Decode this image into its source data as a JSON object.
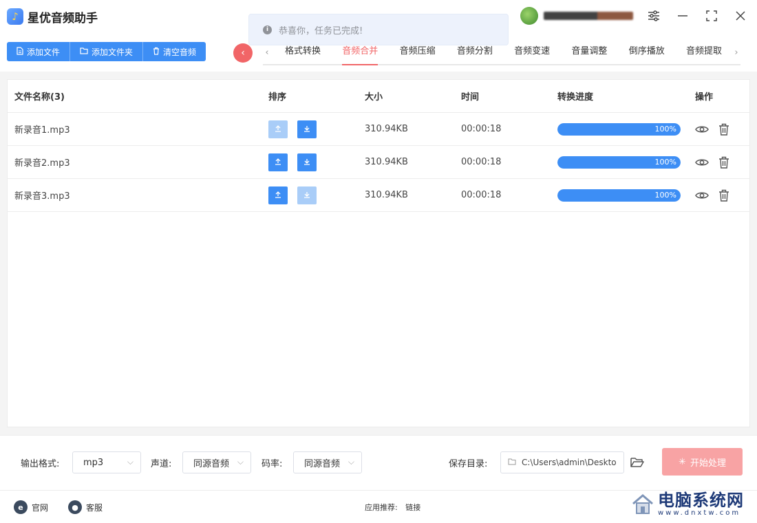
{
  "app": {
    "title": "星优音频助手",
    "logo_icon": "music-note-icon"
  },
  "user": {
    "name": ""
  },
  "toast": {
    "message": "恭喜你，任务已完成!"
  },
  "toolbar": {
    "add_file": "添加文件",
    "add_folder": "添加文件夹",
    "clear": "清空音频"
  },
  "tabs": [
    "格式转换",
    "音频合并",
    "音频压缩",
    "音频分割",
    "音频变速",
    "音量调整",
    "倒序播放",
    "音频提取"
  ],
  "active_tab": "音频合并",
  "table": {
    "headers": {
      "name": "文件名称(3)",
      "order": "排序",
      "size": "大小",
      "time": "时间",
      "progress": "转换进度",
      "ops": "操作"
    },
    "rows": [
      {
        "name": "新录音1.mp3",
        "size": "310.94KB",
        "time": "00:00:18",
        "progress": 100,
        "progress_label": "100%",
        "up_enabled": false,
        "down_enabled": true
      },
      {
        "name": "新录音2.mp3",
        "size": "310.94KB",
        "time": "00:00:18",
        "progress": 100,
        "progress_label": "100%",
        "up_enabled": true,
        "down_enabled": true
      },
      {
        "name": "新录音3.mp3",
        "size": "310.94KB",
        "time": "00:00:18",
        "progress": 100,
        "progress_label": "100%",
        "up_enabled": true,
        "down_enabled": false
      }
    ]
  },
  "settings": {
    "format_label": "输出格式:",
    "format_value": "mp3",
    "channel_label": "声道:",
    "channel_value": "同源音频",
    "bitrate_label": "码率:",
    "bitrate_value": "同源音频",
    "save_label": "保存目录:",
    "save_path": "C:\\Users\\admin\\Deskto",
    "start_button": "开始处理"
  },
  "footer": {
    "official": "官网",
    "support": "客服",
    "recommend_label": "应用推荐:",
    "recommend_link": "链接"
  },
  "watermark": {
    "name": "电脑系统网",
    "url": "www.dnxtw.com"
  },
  "colors": {
    "accent": "#3d8ef5",
    "active_tab": "#f16567",
    "start_button": "#f8a3a4"
  }
}
